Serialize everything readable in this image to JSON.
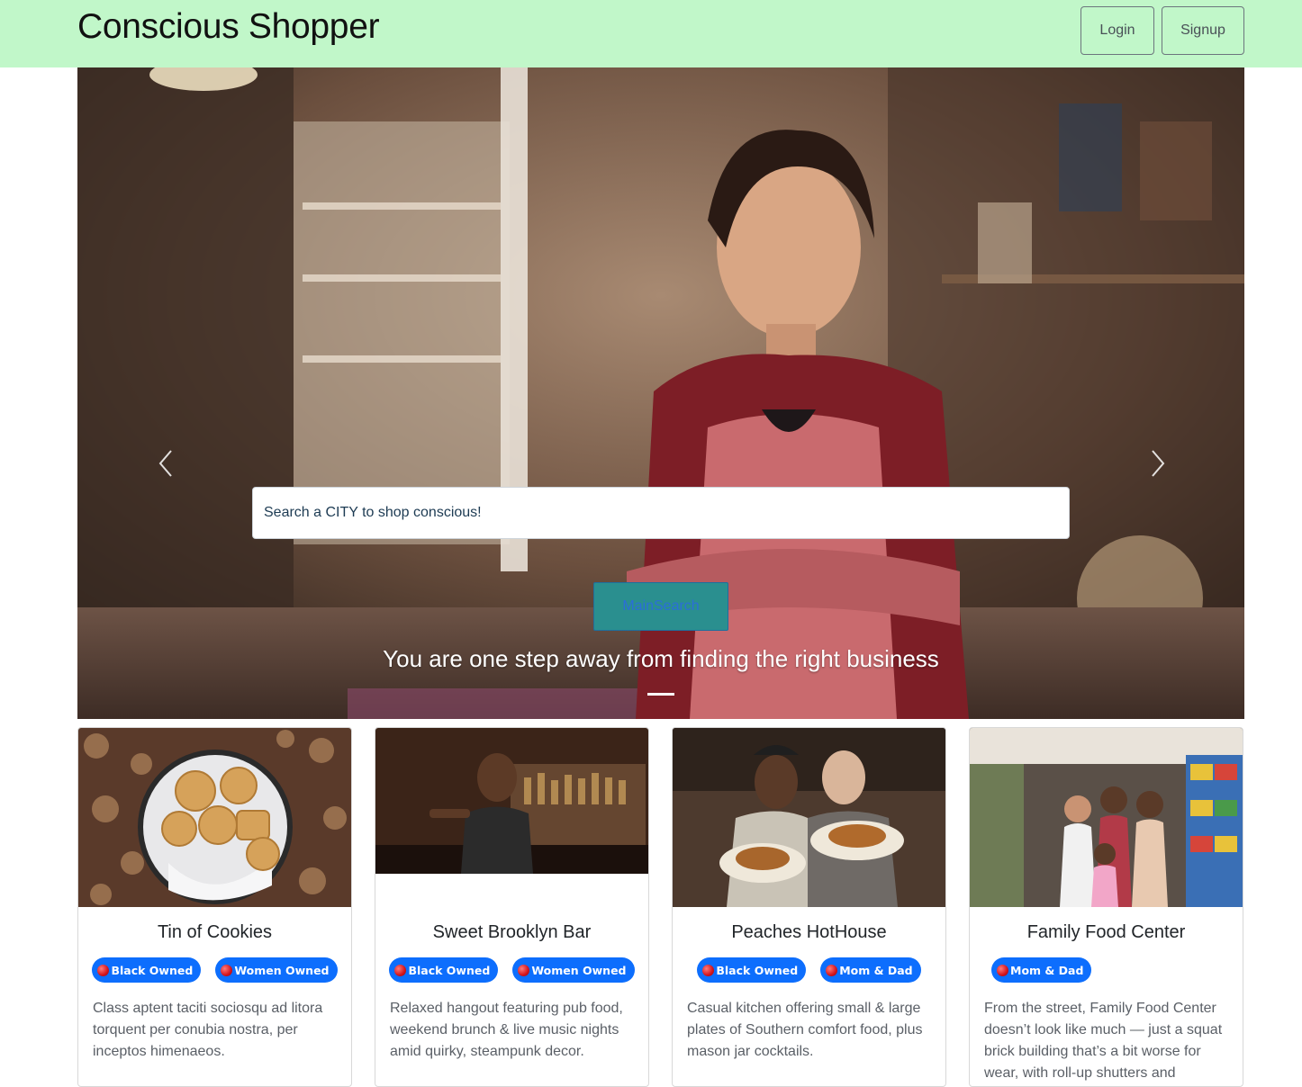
{
  "header": {
    "brand": "Conscious Shopper",
    "login_label": "Login",
    "signup_label": "Signup"
  },
  "hero": {
    "search_placeholder": "Search a CITY to shop conscious!",
    "search_button_label": "MainSearch",
    "caption": "You are one step away from finding the right business",
    "prev_icon": "chevron-left-icon",
    "next_icon": "chevron-right-icon"
  },
  "cards": [
    {
      "title": "Tin of Cookies",
      "badges": [
        "Black Owned",
        "Women Owned"
      ],
      "text": "Class aptent taciti sociosqu ad litora torquent per conubia nostra, per inceptos himenaeos."
    },
    {
      "title": "Sweet Brooklyn Bar",
      "badges": [
        "Black Owned",
        "Women Owned"
      ],
      "text": "Relaxed hangout featuring pub food, weekend brunch & live music nights amid quirky, steampunk decor."
    },
    {
      "title": "Peaches HotHouse",
      "badges": [
        "Black Owned",
        "Mom & Dad"
      ],
      "text": "Casual kitchen offering small & large plates of Southern comfort food, plus mason jar cocktails."
    },
    {
      "title": "Family Food Center",
      "badges": [
        "Mom & Dad"
      ],
      "text": "From the street, Family Food Center doesn’t look like much — just a squat brick building that’s a bit worse for wear, with roll-up shutters and"
    }
  ],
  "colors": {
    "navbar": "#c1f7c9",
    "badge": "#0d6efd",
    "search_button": "#2a8f8f"
  }
}
